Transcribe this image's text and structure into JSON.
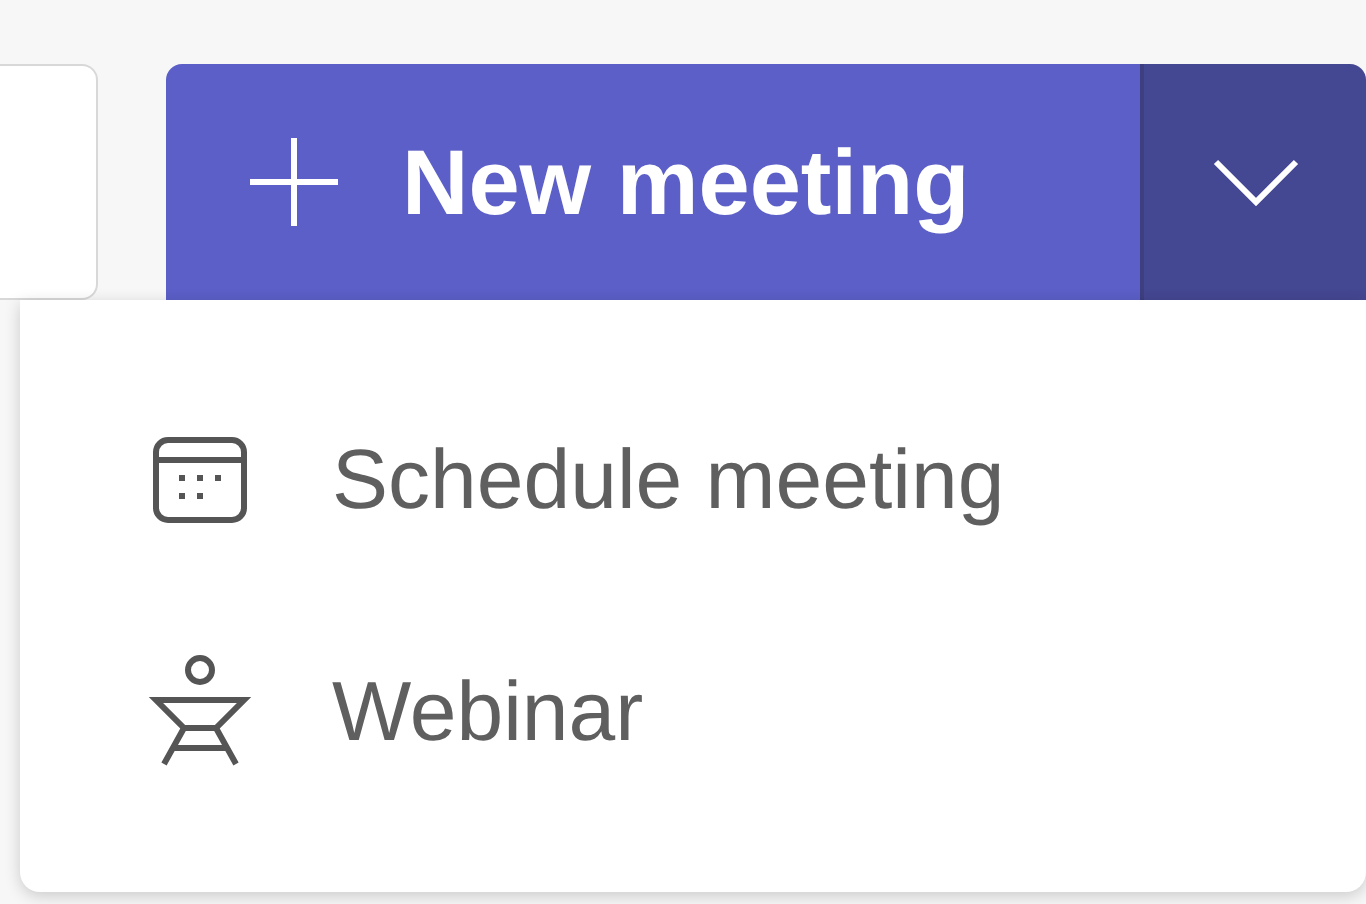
{
  "new_meeting_button": {
    "label": "New meeting"
  },
  "dropdown_toggle": {
    "expanded": true
  },
  "menu": {
    "items": [
      {
        "kind": "calendar",
        "label": "Schedule meeting"
      },
      {
        "kind": "webinar",
        "label": "Webinar"
      }
    ]
  }
}
